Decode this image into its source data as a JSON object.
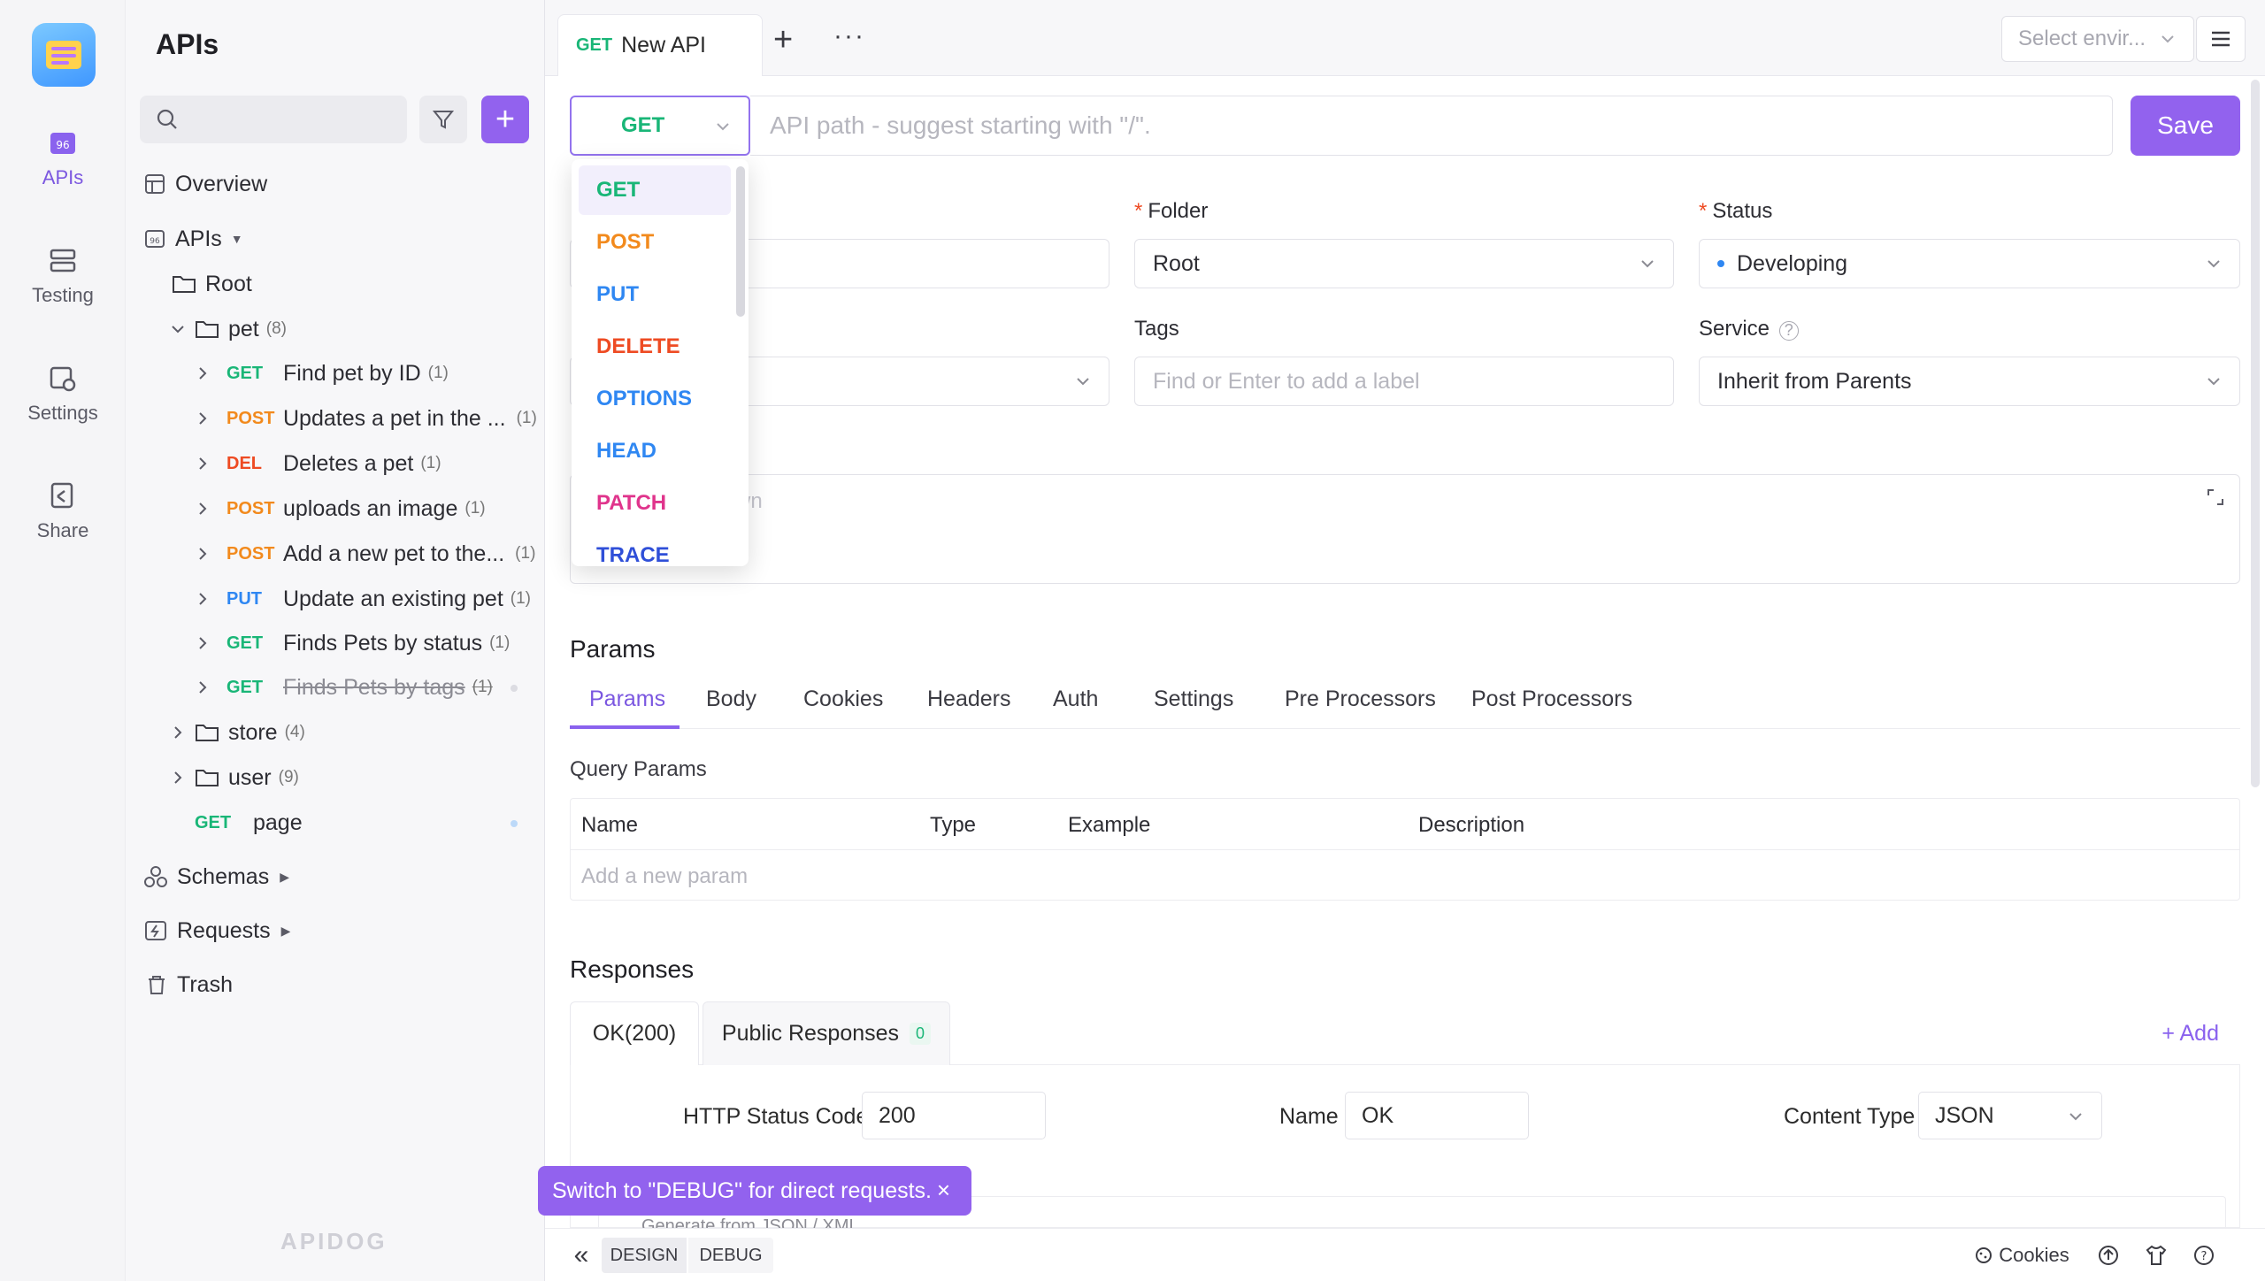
{
  "rail": {
    "items": [
      {
        "label": "APIs",
        "icon": "apis-icon",
        "active": true
      },
      {
        "label": "Testing",
        "icon": "testing-icon",
        "active": false
      },
      {
        "label": "Settings",
        "icon": "settings-icon",
        "active": false
      },
      {
        "label": "Share",
        "icon": "share-icon",
        "active": false
      }
    ]
  },
  "sidebar": {
    "title": "APIs",
    "overview": "Overview",
    "apis": "APIs",
    "root": "Root",
    "pet_folder": {
      "label": "pet",
      "count": "(8)"
    },
    "pet_items": [
      {
        "method": "GET",
        "name": "Find pet by ID",
        "count": "(1)"
      },
      {
        "method": "POST",
        "name": "Updates a pet in the ...",
        "count": "(1)"
      },
      {
        "method": "DEL",
        "name": "Deletes a pet",
        "count": "(1)"
      },
      {
        "method": "POST",
        "name": "uploads an image",
        "count": "(1)"
      },
      {
        "method": "POST",
        "name": "Add a new pet to the...",
        "count": "(1)"
      },
      {
        "method": "PUT",
        "name": "Update an existing pet",
        "count": "(1)"
      },
      {
        "method": "GET",
        "name": "Finds Pets by status",
        "count": "(1)"
      },
      {
        "method": "GET",
        "name": "Finds Pets by tags",
        "count": "(1)"
      }
    ],
    "store_folder": {
      "label": "store",
      "count": "(4)"
    },
    "user_folder": {
      "label": "user",
      "count": "(9)"
    },
    "page_item": {
      "method": "GET",
      "name": "page"
    },
    "schemas": "Schemas",
    "requests": "Requests",
    "trash": "Trash",
    "watermark": "APIDOG"
  },
  "tabbar": {
    "tab_method": "GET",
    "tab_label": "New API",
    "env_placeholder": "Select envir..."
  },
  "request": {
    "method": "GET",
    "path_placeholder": "API path - suggest starting with \"/\".",
    "save_label": "Save"
  },
  "method_options": [
    "GET",
    "POST",
    "PUT",
    "DELETE",
    "OPTIONS",
    "HEAD",
    "PATCH",
    "TRACE"
  ],
  "method_colors": {
    "GET": "#19b677",
    "POST": "#f28a1d",
    "PUT": "#2f87f2",
    "DELETE": "#ee4b23",
    "OPTIONS": "#2f87f2",
    "HEAD": "#2f87f2",
    "PATCH": "#e0348c",
    "TRACE": "#2f4fd8"
  },
  "form": {
    "folder_label": "Folder",
    "folder_value": "Root",
    "status_label": "Status",
    "status_value": "Developing",
    "tags_label": "Tags",
    "tags_placeholder": "Find or Enter to add a label",
    "service_label": "Service",
    "service_value": "Inherit from Parents",
    "desc_partial": "wn"
  },
  "params": {
    "heading": "Params",
    "tabs": [
      "Params",
      "Body",
      "Cookies",
      "Headers",
      "Auth",
      "Settings",
      "Pre Processors",
      "Post Processors"
    ],
    "query_heading": "Query Params",
    "columns": [
      "Name",
      "Type",
      "Example",
      "Description"
    ],
    "add_placeholder": "Add a new param"
  },
  "responses": {
    "heading": "Responses",
    "tab_ok": "OK(200)",
    "tab_public": "Public Responses",
    "public_count": "0",
    "add_label": "+ Add",
    "status_code_label": "HTTP Status Code",
    "status_code_value": "200",
    "name_label": "Name",
    "name_value": "OK",
    "content_type_label": "Content Type",
    "content_type_value": "JSON",
    "generate_partial": "Generate from JSON / XML"
  },
  "toast": {
    "text": "Switch to \"DEBUG\" for direct requests.",
    "close": "×"
  },
  "bottom": {
    "collapse": "«",
    "design": "DESIGN",
    "debug": "DEBUG",
    "cookies": "Cookies"
  },
  "colors": {
    "accent": "#9262ee",
    "get": "#19b677",
    "post": "#f28a1d",
    "delete": "#ee4b23",
    "put": "#2f87f2",
    "required": "#ee4b23",
    "status_dot": "#2f87f2"
  }
}
